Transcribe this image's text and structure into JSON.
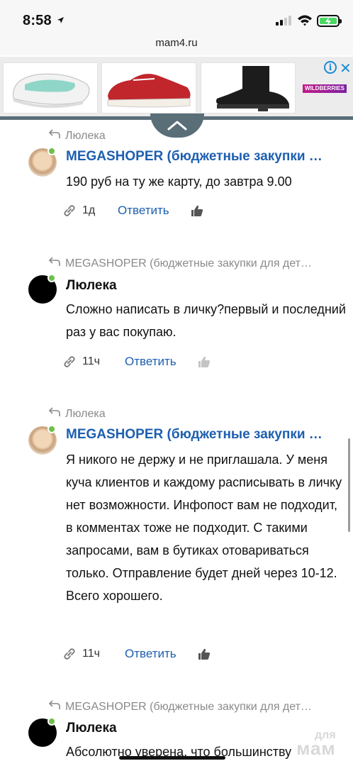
{
  "status": {
    "time": "8:58"
  },
  "browser": {
    "url": "mam4.ru"
  },
  "ad": {
    "brand_badge": "WILDBERRIES",
    "info_glyph": "i",
    "close_glyph": "✕"
  },
  "comments": [
    {
      "reply_to": "Люлека",
      "author": "MEGASHOPER (бюджетные закупки …",
      "author_style": "blue",
      "avatar": "photo",
      "text": "190 руб на ту же карту, до завтра 9.00",
      "time": "1д",
      "reply_label": "Ответить",
      "like_state": "active"
    },
    {
      "reply_to": "MEGASHOPER (бюджетные закупки для дет…",
      "author": "Люлека",
      "author_style": "dark",
      "avatar": "black",
      "text": "Сложно написать в личку?первый и последний раз у вас покупаю.",
      "time": "11ч",
      "reply_label": "Ответить",
      "like_state": "inactive"
    },
    {
      "reply_to": "Люлека",
      "author": "MEGASHOPER (бюджетные закупки …",
      "author_style": "blue",
      "avatar": "photo",
      "text": "Я никого не держу и не приглашала. У меня куча клиентов и каждому расписывать в личку нет возможности. Инфопост вам не подходит, в комментах тоже не подходит. С такими запросами, вам в бутиках отовариваться только. Отправление будет дней через 10-12. Всего хорошего.",
      "time": "11ч",
      "reply_label": "Ответить",
      "like_state": "active"
    },
    {
      "reply_to": "MEGASHOPER (бюджетные закупки для дет…",
      "author": "Люлека",
      "author_style": "dark",
      "avatar": "black",
      "text": "Абсолютно уверена, что большинству",
      "time": "",
      "reply_label": "",
      "like_state": ""
    }
  ],
  "watermark": {
    "line1": "для",
    "line2": "мам"
  },
  "colors": {
    "link_blue": "#1d5fb0",
    "online_green": "#6cc04a",
    "banner_bar": "#5a6e78"
  }
}
